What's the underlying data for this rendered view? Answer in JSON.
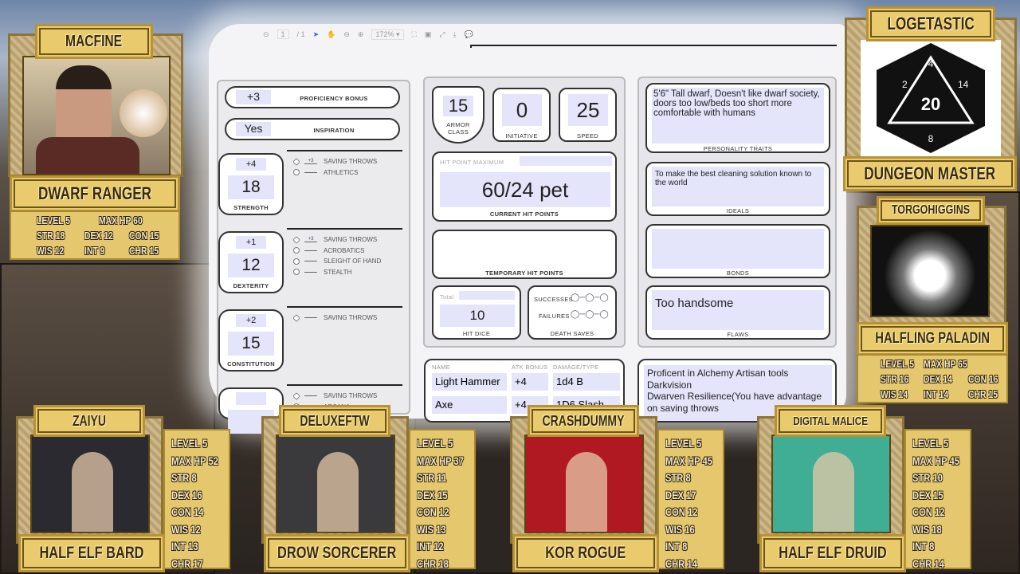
{
  "pdf_toolbar": {
    "page_current": "1",
    "page_total": "/ 1",
    "zoom": "172%"
  },
  "sheet": {
    "proficiency_bonus": {
      "value": "+3",
      "label": "PROFICIENCY BONUS"
    },
    "inspiration": {
      "value": "Yes",
      "label": "INSPIRATION"
    },
    "abilities": [
      {
        "mod": "+4",
        "score": "18",
        "label": "STRENGTH",
        "skills": [
          {
            "prof": "+3",
            "name": "SAVING THROWS"
          },
          {
            "prof": "",
            "name": "ATHLETICS"
          }
        ]
      },
      {
        "mod": "+1",
        "score": "12",
        "label": "DEXTERITY",
        "skills": [
          {
            "prof": "+3",
            "name": "SAVING THROWS"
          },
          {
            "prof": "",
            "name": "ACROBATICS"
          },
          {
            "prof": "",
            "name": "SLEIGHT OF HAND"
          },
          {
            "prof": "",
            "name": "STEALTH"
          }
        ]
      },
      {
        "mod": "+2",
        "score": "15",
        "label": "CONSTITUTION",
        "skills": [
          {
            "prof": "",
            "name": "SAVING THROWS"
          }
        ]
      },
      {
        "mod": "",
        "score": "",
        "label": "",
        "skills": [
          {
            "prof": "",
            "name": "SAVING THROWS"
          },
          {
            "prof": "",
            "name": "ARCANA"
          }
        ]
      }
    ],
    "armor_class": {
      "value": "15",
      "label": "ARMOR CLASS"
    },
    "initiative": {
      "value": "0",
      "label": "INITIATIVE"
    },
    "speed": {
      "value": "25",
      "label": "SPEED"
    },
    "hp_max_label": "HIT POINT MAXIMUM",
    "current_hp": {
      "value": "60/24 pet",
      "label": "CURRENT HIT POINTS"
    },
    "temp_hp_label": "TEMPORARY HIT POINTS",
    "hit_dice": {
      "total_label": "Total",
      "value": "10",
      "label": "HIT DICE"
    },
    "death_saves": {
      "successes": "SUCCESSES",
      "failures": "FAILURES",
      "label": "DEATH SAVES"
    },
    "personality_traits": {
      "value": "5'6\" Tall dwarf, Doesn't like dwarf society, doors too low/beds too short more comfortable with humans",
      "label": "PERSONALITY TRAITS"
    },
    "ideals": {
      "value": "To make the best cleaning solution known to the world",
      "label": "IDEALS"
    },
    "bonds": {
      "value": "",
      "label": "BONDS"
    },
    "flaws": {
      "value": "Too handsome",
      "label": "FLAWS"
    },
    "attacks": {
      "headers": [
        "NAME",
        "ATK BONUS",
        "DAMAGE/TYPE"
      ],
      "rows": [
        [
          "Light Hammer",
          "+4",
          "1d4 B"
        ],
        [
          "Axe",
          "+4",
          "1D6 Slash"
        ]
      ]
    },
    "features": "Proficent in Alchemy Artisan tools\nDarkvision\nDwarven Resilience(You have advantage on saving throws"
  },
  "players": {
    "macfine": {
      "name": "MACFINE",
      "class": "DWARF RANGER",
      "level": "5",
      "max_hp": "60",
      "str": "18",
      "dex": "12",
      "con": "15",
      "wis": "12",
      "int": "9",
      "chr": "15"
    },
    "dm": {
      "name": "LOGETASTIC",
      "role": "DUNGEON MASTER"
    },
    "torgohiggins": {
      "name": "TORGOHIGGINS",
      "class": "HALFLING PALADIN",
      "level": "5",
      "max_hp": "65",
      "str": "16",
      "dex": "14",
      "con": "16",
      "wis": "14",
      "int": "14",
      "chr": "15"
    },
    "bottom": [
      {
        "name": "ZAIYU",
        "class": "HALF ELF BARD",
        "level": "5",
        "max_hp": "52",
        "str": "8",
        "dex": "16",
        "con": "14",
        "wis": "12",
        "int": "13",
        "chr": "17",
        "bg": "#2a2a30"
      },
      {
        "name": "DELUXEFTW",
        "class": "DROW SORCERER",
        "level": "5",
        "max_hp": "37",
        "str": "11",
        "dex": "15",
        "con": "12",
        "wis": "13",
        "int": "12",
        "chr": "18",
        "bg": "#3a3a3c"
      },
      {
        "name": "CRASHDUMMY",
        "class": "KOR ROGUE",
        "level": "5",
        "max_hp": "45",
        "str": "8",
        "dex": "17",
        "con": "12",
        "wis": "16",
        "int": "8",
        "chr": "14",
        "bg": "#b01822"
      },
      {
        "name": "DIGITAL MALICE",
        "class": "HALF ELF DRUID",
        "level": "5",
        "max_hp": "45",
        "str": "10",
        "dex": "15",
        "con": "12",
        "wis": "18",
        "int": "8",
        "chr": "14",
        "bg": "#3fae94"
      }
    ],
    "stat_labels": {
      "level": "LEVEL",
      "max_hp": "MAX HP",
      "str": "STR",
      "dex": "DEX",
      "con": "CON",
      "wis": "WIS",
      "int": "INT",
      "chr": "CHR"
    }
  },
  "colors": {
    "gold": "#e9cb6e",
    "field": "#e4e4fa"
  }
}
